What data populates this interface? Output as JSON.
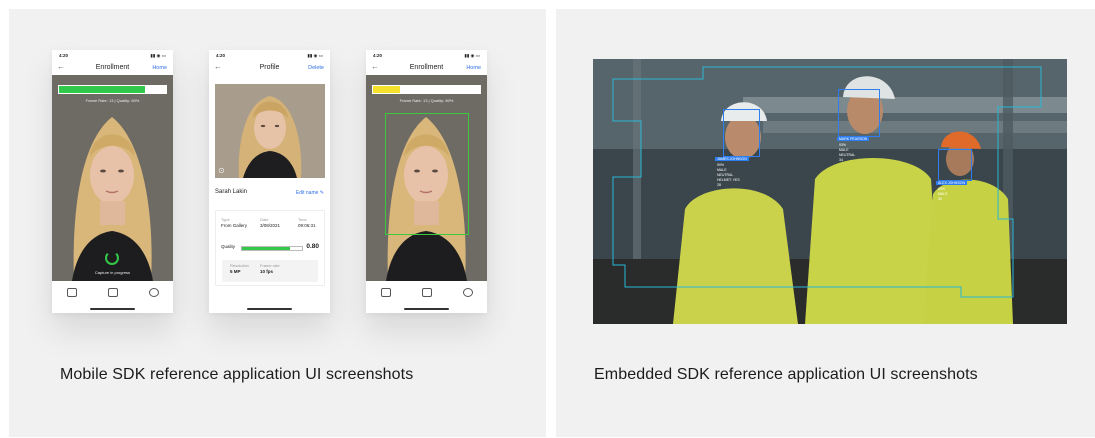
{
  "left": {
    "caption": "Mobile SDK reference application UI screenshots",
    "phones": {
      "enrollment1": {
        "status_time": "4:20",
        "title": "Enrollment",
        "action": "Home",
        "bar_color": "#2fc84a",
        "bar_progress": 0.8,
        "metrics": "Frame Rate: 13  |  Quality: 80%",
        "capture_text": "Capture in progress"
      },
      "profile": {
        "status_time": "4:20",
        "title": "Profile",
        "action": "Delete",
        "name": "Sarah Lakin",
        "edit_label": "Edit name",
        "type_label": "Type",
        "type_value": "From Gallery",
        "date_label": "Date",
        "date_value": "3/08/2021",
        "time_label": "Time",
        "time_value": "09:06:31",
        "quality_label": "Quality",
        "quality_progress": 0.8,
        "quality_value": "0.80",
        "resolution_label": "Resolution",
        "resolution_value": "5 MP",
        "framerate_label": "Frame rate",
        "framerate_value": "10 fps"
      },
      "enrollment2": {
        "status_time": "4:20",
        "title": "Enrollment",
        "action": "Home",
        "bar_color": "#f5e12a",
        "bar_progress": 0.25,
        "metrics": "Frame Rate: 13  |  Quality: 80%"
      }
    }
  },
  "right": {
    "caption": "Embedded SDK reference application UI screenshots",
    "detections": [
      {
        "label": "JAMES JOHNSON",
        "attrs": [
          "90%",
          "MALE",
          "NEUTRAL",
          "HELMET: YES",
          "28"
        ]
      },
      {
        "label": "MARK PEARSON",
        "attrs": [
          "93%",
          "MALE",
          "NEUTRAL",
          "34"
        ]
      },
      {
        "label": "ALEX JOHNSON",
        "attrs": [
          "89%",
          "MALE",
          "30"
        ]
      }
    ]
  },
  "colors": {
    "accent_blue": "#2f6fe8",
    "detection_blue": "#2f7ef0",
    "roi_cyan": "#29b6d6",
    "ok_green": "#34c84a",
    "panel_bg": "#f1f1f1"
  }
}
